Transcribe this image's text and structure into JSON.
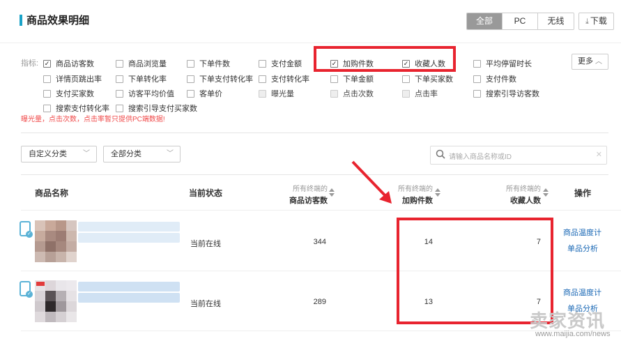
{
  "header": {
    "title": "商品效果明细",
    "segments": [
      "全部",
      "PC",
      "无线"
    ],
    "download_label": "下载",
    "download_icon": "download-icon"
  },
  "indicators": {
    "label": "指标:",
    "items": [
      {
        "label": "商品访客数",
        "checked": true
      },
      {
        "label": "商品浏览量",
        "checked": false
      },
      {
        "label": "下单件数",
        "checked": false
      },
      {
        "label": "支付金额",
        "checked": false
      },
      {
        "label": "加购件数",
        "checked": true
      },
      {
        "label": "收藏人数",
        "checked": true
      },
      {
        "label": "平均停留时长",
        "checked": false
      },
      {
        "label": "详情页跳出率",
        "checked": false
      },
      {
        "label": "下单转化率",
        "checked": false
      },
      {
        "label": "下单支付转化率",
        "checked": false
      },
      {
        "label": "支付转化率",
        "checked": false
      },
      {
        "label": "下单金额",
        "checked": false
      },
      {
        "label": "下单买家数",
        "checked": false
      },
      {
        "label": "支付件数",
        "checked": false
      },
      {
        "label": "支付买家数",
        "checked": false
      },
      {
        "label": "访客平均价值",
        "checked": false
      },
      {
        "label": "客单价",
        "checked": false
      },
      {
        "label": "曝光量",
        "checked": false,
        "disabled": true
      },
      {
        "label": "点击次数",
        "checked": false,
        "disabled": true
      },
      {
        "label": "点击率",
        "checked": false,
        "disabled": true
      },
      {
        "label": "搜索引导访客数",
        "checked": false
      },
      {
        "label": "搜索支付转化率",
        "checked": false
      },
      {
        "label": "搜索引导支付买家数",
        "checked": false
      }
    ],
    "more_label": "更多",
    "note": "曝光量，点击次数，点击率暂只提供PC端数据!"
  },
  "filters": {
    "category_custom": "自定义分类",
    "category_all": "全部分类",
    "search_placeholder": "请输入商品名称或ID"
  },
  "table": {
    "headers": {
      "name": "商品名称",
      "status": "当前状态",
      "col_prefix": "所有终端的",
      "visitors": "商品访客数",
      "cart": "加购件数",
      "fav": "收藏人数",
      "op": "操作"
    },
    "rows": [
      {
        "status": "当前在线",
        "visitors": "344",
        "cart": "14",
        "fav": "7",
        "op1": "商品温度计",
        "op2": "单品分析"
      },
      {
        "status": "当前在线",
        "visitors": "289",
        "cart": "13",
        "fav": "7",
        "op1": "商品温度计",
        "op2": "单品分析"
      }
    ]
  },
  "watermark": {
    "brand": "卖家资讯",
    "url": "www.maijia.com/news"
  },
  "colors": {
    "accent": "#1aa3c8",
    "highlight": "#e8242f",
    "link": "#1a68b5",
    "warning": "#f04b4b"
  }
}
